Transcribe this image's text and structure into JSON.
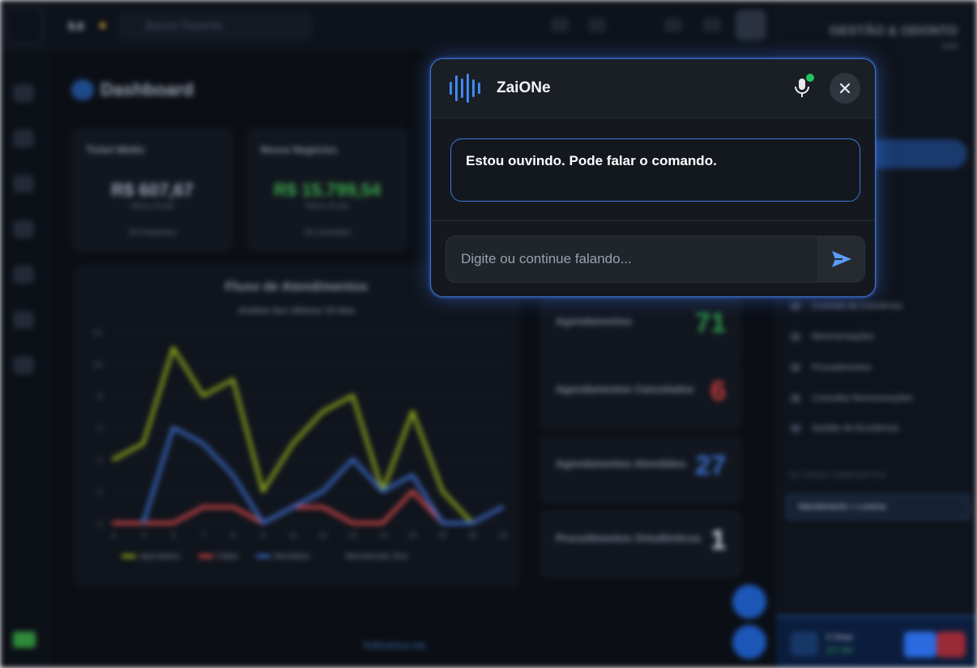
{
  "modal": {
    "title": "ZaiONe",
    "message": "Estou ouvindo. Pode falar o comando.",
    "input_placeholder": "Digite ou continue falando...",
    "input_value": "",
    "status_color": "#22c55e",
    "accent_color": "#3d73d6",
    "icons": {
      "logo": "audio-wave-icon",
      "mic": "microphone-icon",
      "close": "close-icon",
      "send": "send-icon"
    }
  },
  "background": {
    "dashboard_title": "Dashboard",
    "cards": [
      {
        "title": "Ticket Médio",
        "value": "R$ 607,67",
        "sub": "Últimos 30 dias",
        "footer": "23 Pacientes",
        "color": "#9aa3b3"
      },
      {
        "title": "Novos Negócios",
        "value": "R$ 15.799,54",
        "sub": "Últimos 30 dias",
        "footer": "26 Contratos",
        "color": "#3aa84a"
      }
    ],
    "chart_data": {
      "type": "line",
      "title": "Fluxo de Atendimentos",
      "subtitle": "Análise dos últimos 15 dias",
      "x": [
        4,
        5,
        6,
        7,
        8,
        9,
        11,
        12,
        13,
        14,
        15,
        16,
        18,
        19
      ],
      "ylim": [
        0,
        12
      ],
      "yticks": [
        0,
        2,
        4,
        6,
        8,
        10,
        12
      ],
      "series": [
        {
          "name": "Agendados",
          "color": "#9aae1c",
          "values": [
            4,
            5,
            11,
            8,
            9,
            2,
            5,
            7,
            8,
            2,
            7,
            2,
            0,
            null
          ]
        },
        {
          "name": "Faltas",
          "color": "#d94848",
          "values": [
            0,
            0,
            0,
            1,
            1,
            0,
            1,
            1,
            0,
            0,
            2,
            0,
            null,
            null
          ]
        },
        {
          "name": "Atendidos",
          "color": "#3b6fd0",
          "values": [
            null,
            0,
            6,
            5,
            3,
            0,
            1,
            2,
            4,
            2,
            3,
            0,
            0,
            1
          ]
        },
        {
          "name": "Manutenção Orto",
          "color": "#6a7282",
          "values": []
        }
      ]
    },
    "stats": [
      {
        "label": "Agendamentos",
        "value": "71",
        "color": "#2f9a4c"
      },
      {
        "label": "Agendamentos Cancelados",
        "value": "6",
        "color": "#c83c3c"
      },
      {
        "label": "Agendamentos Atendidos",
        "value": "27",
        "color": "#3b6fd0"
      },
      {
        "label": "Procedimentos Ortodônticos",
        "value": "1",
        "color": "#c9d0dc"
      }
    ],
    "right_menu": [
      "Controle de Convênios",
      "Movimentações",
      "Procedimentos",
      "Consultar Remunerações",
      "Gestão de Excelência"
    ],
    "right_section": "ÚLTIMOS AMBIENTES",
    "right_chip": "Atendimento » Lorena",
    "version": "5.0",
    "search_placeholder": "Buscar Paciente",
    "brand": "GESTÃO & ODONTO",
    "brand_sub": "CRM",
    "footer_brand": "Softvetrina.net"
  }
}
